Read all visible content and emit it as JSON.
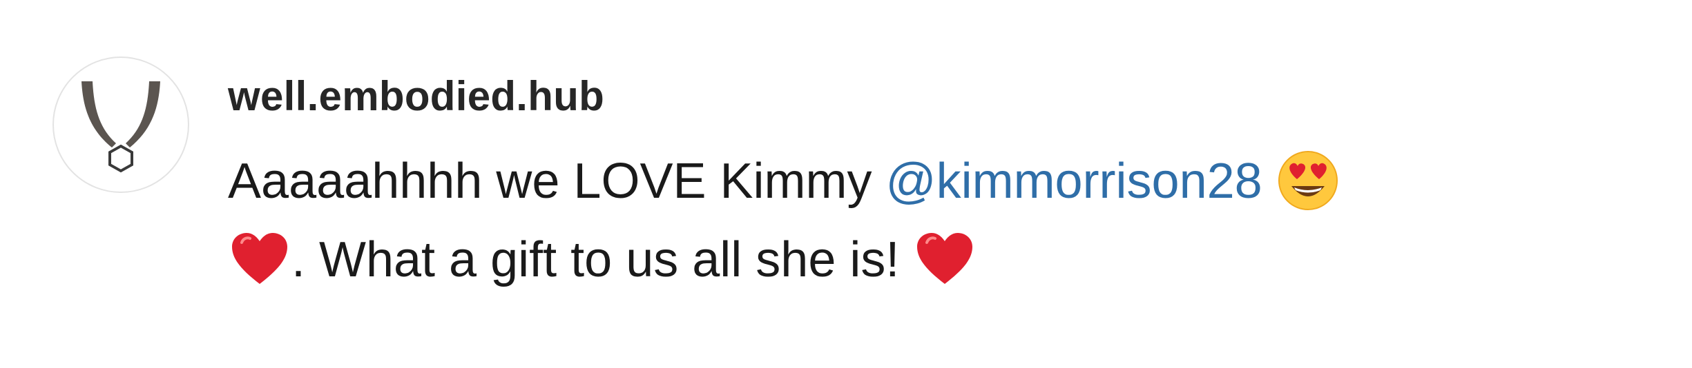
{
  "comment": {
    "username": "well.embodied.hub",
    "text_part1": "Aaaaahhhh we LOVE Kimmy ",
    "mention": "@kimmorrison28",
    "text_part2": ". What a gift to us all she is!",
    "emojis": [
      "heart-eyes-emoji",
      "red-heart-emoji",
      "red-heart-emoji"
    ]
  },
  "colors": {
    "mention": "#2f6ea8",
    "username": "#262626",
    "text": "#1a1a1a",
    "heart": "#e0202f",
    "emoji_face": "#ffc83d"
  }
}
